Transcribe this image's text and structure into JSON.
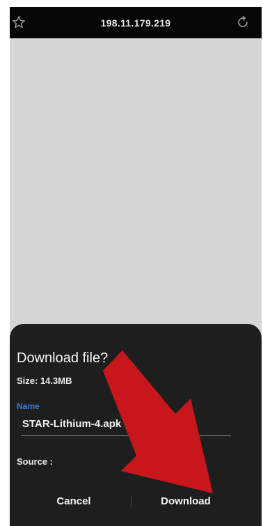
{
  "browser": {
    "url": "198.11.179.219"
  },
  "dialog": {
    "title": "Download file?",
    "size_text": "Size: 14.3MB",
    "name_label": "Name",
    "name_value": "STAR-Lithium-4.apk",
    "source_text": "Source :",
    "cancel_label": "Cancel",
    "download_label": "Download"
  },
  "annotation": {
    "arrow_color": "#c8161d"
  },
  "colors": {
    "accent_blue": "#3d7be0",
    "sheet_background": "#1e1e1e",
    "page_background": "#d6d6d6"
  },
  "icons": {
    "left": "star-icon",
    "right": "refresh-icon"
  }
}
